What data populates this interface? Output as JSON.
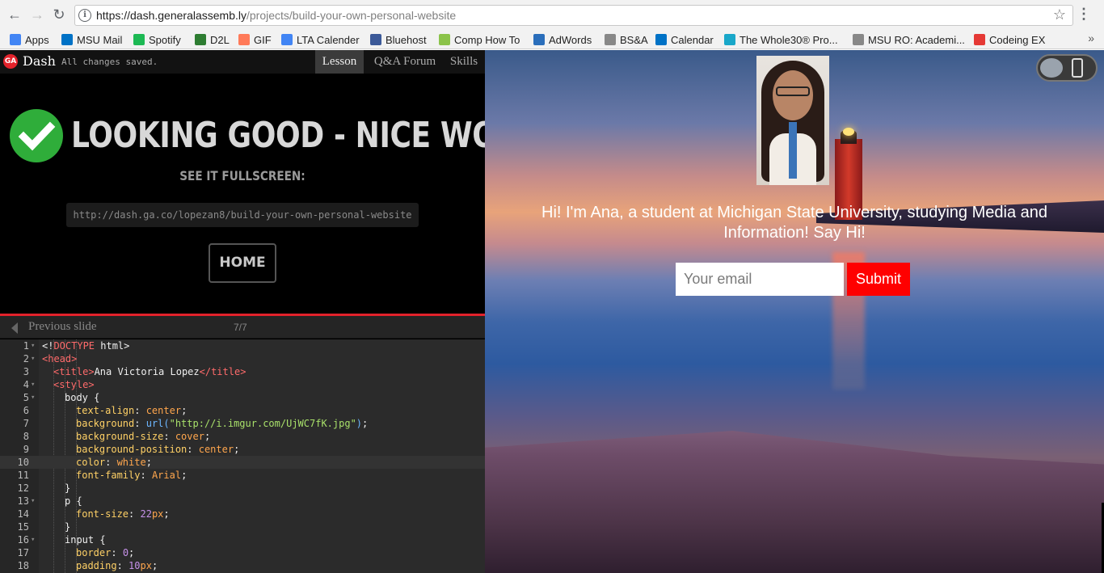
{
  "browser": {
    "url_host": "https://dash.generalassemb.ly",
    "url_path": "/projects/build-your-own-personal-website",
    "bookmarks": [
      {
        "label": "Apps",
        "icon": "apps-grid-icon",
        "color": "#4285f4"
      },
      {
        "label": "MSU Mail",
        "icon": "outlook-icon",
        "color": "#0072c6"
      },
      {
        "label": "Spotify",
        "icon": "spotify-icon",
        "color": "#1db954"
      },
      {
        "label": "D2L",
        "icon": "d2l-icon",
        "color": "#2e7d32"
      },
      {
        "label": "GIF",
        "icon": "hubspot-icon",
        "color": "#ff7a59"
      },
      {
        "label": "LTA Calender",
        "icon": "calendar-3-icon",
        "color": "#4285f4"
      },
      {
        "label": "Bluehost",
        "icon": "bluehost-icon",
        "color": "#3b5998"
      },
      {
        "label": "Comp How To",
        "icon": "h-icon",
        "color": "#8bc34a"
      },
      {
        "label": "AdWords",
        "icon": "globe-icon",
        "color": "#2a6ebb"
      },
      {
        "label": "BS&A",
        "icon": "page-icon",
        "color": "#888888"
      },
      {
        "label": "Calendar",
        "icon": "outlook-icon",
        "color": "#0072c6"
      },
      {
        "label": "The Whole30® Pro...",
        "icon": "whole30-icon",
        "color": "#19a7c9"
      },
      {
        "label": "MSU RO: Academi...",
        "icon": "page-icon",
        "color": "#888888"
      },
      {
        "label": "Codeing EX",
        "icon": "codeing-icon",
        "color": "#e53935"
      }
    ],
    "more_label": "»"
  },
  "dash": {
    "logo": "GA",
    "name": "Dash",
    "saved_status": "All changes saved.",
    "tabs": [
      "Lesson",
      "Q&A Forum",
      "Skills"
    ],
    "headline": "LOOKING GOOD - NICE WORK!",
    "fullscreen_label": "SEE IT FULLSCREEN:",
    "share_url": "http://dash.ga.co/lopezan8/build-your-own-personal-website",
    "home_label": "HOME",
    "prev_slide_label": "Previous slide",
    "slide_count": "7/7"
  },
  "code_lines": [
    {
      "n": "1",
      "fold": true,
      "indent": 0,
      "parts": [
        [
          "plain",
          "<!"
        ],
        [
          "tag",
          "DOCTYPE"
        ],
        [
          "plain",
          " html>"
        ]
      ]
    },
    {
      "n": "2",
      "fold": true,
      "indent": 0,
      "parts": [
        [
          "tag",
          "<head>"
        ]
      ]
    },
    {
      "n": "3",
      "fold": false,
      "indent": 1,
      "parts": [
        [
          "tag",
          "<title>"
        ],
        [
          "plain",
          "Ana Victoria Lopez"
        ],
        [
          "tag",
          "</title>"
        ]
      ]
    },
    {
      "n": "4",
      "fold": true,
      "indent": 1,
      "parts": [
        [
          "tag",
          "<style>"
        ]
      ]
    },
    {
      "n": "5",
      "fold": true,
      "indent": 2,
      "parts": [
        [
          "plain",
          "body {"
        ]
      ]
    },
    {
      "n": "6",
      "fold": false,
      "indent": 3,
      "parts": [
        [
          "prop",
          "text-align"
        ],
        [
          "plain",
          ": "
        ],
        [
          "val",
          "center"
        ],
        [
          "plain",
          ";"
        ]
      ]
    },
    {
      "n": "7",
      "fold": false,
      "indent": 3,
      "parts": [
        [
          "prop",
          "background"
        ],
        [
          "plain",
          ": "
        ],
        [
          "fn",
          "url("
        ],
        [
          "str",
          "\"http://i.imgur.com/UjWC7fK.jpg\""
        ],
        [
          "fn",
          ")"
        ],
        [
          "plain",
          ";"
        ]
      ]
    },
    {
      "n": "8",
      "fold": false,
      "indent": 3,
      "parts": [
        [
          "prop",
          "background-size"
        ],
        [
          "plain",
          ": "
        ],
        [
          "val",
          "cover"
        ],
        [
          "plain",
          ";"
        ]
      ]
    },
    {
      "n": "9",
      "fold": false,
      "indent": 3,
      "parts": [
        [
          "prop",
          "background-position"
        ],
        [
          "plain",
          ": "
        ],
        [
          "val",
          "center"
        ],
        [
          "plain",
          ";"
        ]
      ]
    },
    {
      "n": "10",
      "fold": false,
      "indent": 3,
      "active": true,
      "parts": [
        [
          "prop",
          "color"
        ],
        [
          "plain",
          ": "
        ],
        [
          "val",
          "white"
        ],
        [
          "plain",
          ";"
        ]
      ]
    },
    {
      "n": "11",
      "fold": false,
      "indent": 3,
      "parts": [
        [
          "prop",
          "font-family"
        ],
        [
          "plain",
          ": "
        ],
        [
          "val",
          "Arial"
        ],
        [
          "plain",
          ";"
        ]
      ]
    },
    {
      "n": "12",
      "fold": false,
      "indent": 2,
      "parts": [
        [
          "plain",
          "}"
        ]
      ]
    },
    {
      "n": "13",
      "fold": true,
      "indent": 2,
      "parts": [
        [
          "plain",
          "p {"
        ]
      ]
    },
    {
      "n": "14",
      "fold": false,
      "indent": 3,
      "parts": [
        [
          "prop",
          "font-size"
        ],
        [
          "plain",
          ": "
        ],
        [
          "num",
          "22"
        ],
        [
          "val",
          "px"
        ],
        [
          "plain",
          ";"
        ]
      ]
    },
    {
      "n": "15",
      "fold": false,
      "indent": 2,
      "parts": [
        [
          "plain",
          "}"
        ]
      ]
    },
    {
      "n": "16",
      "fold": true,
      "indent": 2,
      "parts": [
        [
          "plain",
          "input {"
        ]
      ]
    },
    {
      "n": "17",
      "fold": false,
      "indent": 3,
      "parts": [
        [
          "prop",
          "border"
        ],
        [
          "plain",
          ": "
        ],
        [
          "num",
          "0"
        ],
        [
          "plain",
          ";"
        ]
      ]
    },
    {
      "n": "18",
      "fold": false,
      "indent": 3,
      "parts": [
        [
          "prop",
          "padding"
        ],
        [
          "plain",
          ": "
        ],
        [
          "num",
          "10"
        ],
        [
          "val",
          "px"
        ],
        [
          "plain",
          ";"
        ]
      ]
    }
  ],
  "preview": {
    "intro_text": "Hi! I'm Ana, a student at Michigan State University, studying Media and Information! Say Hi!",
    "email_placeholder": "Your email",
    "submit_label": "Submit"
  },
  "colors": {
    "accent_red": "#e3222b",
    "success_green": "#2fad3a",
    "submit_red": "#ff0000"
  }
}
